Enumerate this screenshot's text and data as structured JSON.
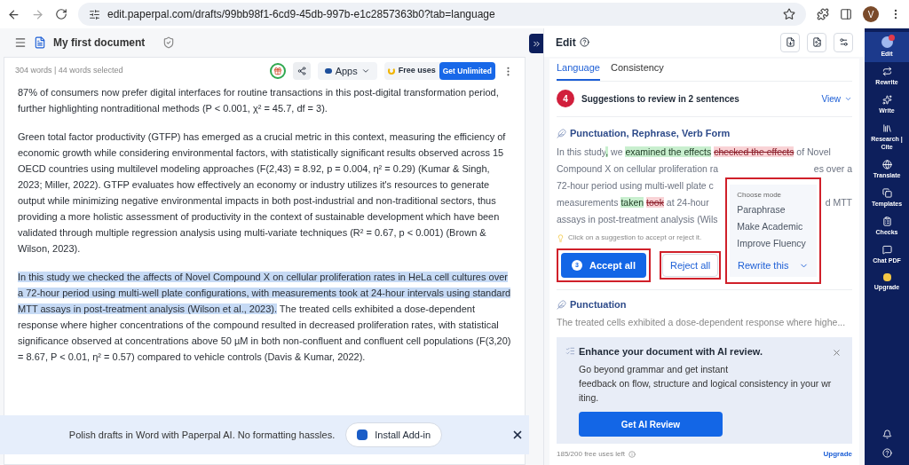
{
  "browser": {
    "url": "edit.paperpal.com/drafts/99bb98f1-6cd9-45db-997b-e1c2857363b0?tab=language",
    "avatar": "V"
  },
  "document": {
    "title": "My first document",
    "word_count": "304 words | 44 words selected",
    "apps": "Apps",
    "free_uses": "Free uses",
    "upgrade_button": "Get Unlimited",
    "paragraphs": [
      [
        {
          "text": "87% of consumers now prefer digital interfaces for routine transactions in this post-digital transformation period, further highlighting nontraditional methods (P < 0.001, χ² = 45.7, df = 3).",
          "selected": false
        }
      ],
      [
        {
          "text": "Green total factor productivity (GTFP) has emerged as a crucial metric in this context, measuring the efficiency of economic growth while considering environmental factors, with statistically significant results observed across 15 OECD countries using multilevel modeling approaches (F(2,43) = 8.92, p = 0.004, η² = 0.29) (Kumar & Singh, 2023; Miller, 2022). GTFP evaluates how effectively an economy or industry utilizes it's resources to generate output while minimizing negative environmental impacts in both post-industrial and non-traditional sectors, thus providing a more holistic assessment of productivity in the context of sustainable development which have been validated through multiple regression analysis using multi-variate techniques (R² = 0.67, p < 0.001) (Brown & Wilson, 2023).",
          "selected": false
        }
      ],
      [
        {
          "text": "In this study we checked the affects of Novel Compound X on cellular proliferation rates in HeLa cell cultures over a 72-hour period using multi-well plate configurations, with measurements took at 24-hour intervals using standard MTT assays in post-treatment analysis (Wilson et al., 2023).",
          "selected": true
        },
        {
          "text": " The treated cells exhibited a dose-dependent response where higher concentrations of the compound resulted in decreased proliferation rates, with statistical significance observed at concentrations above 50 µM in both non-confluent and confluent cell populations (F(3,20) = 8.67, P < 0.01, η² = 0.57) compared to vehicle controls (Davis & Kumar, 2022).",
          "selected": false
        }
      ]
    ]
  },
  "banner": {
    "text": "Polish drafts in Word with Paperpal AI. No formatting hassles.",
    "button": "Install Add-in"
  },
  "panel": {
    "title": "Edit",
    "tabs": [
      {
        "label": "Language",
        "selected": true
      },
      {
        "label": "Consistency",
        "selected": false
      }
    ],
    "summary": {
      "count": "4",
      "text": "Suggestions to review in 2 sentences",
      "view": "View"
    },
    "card": {
      "title": "Punctuation, Rephrase, Verb Form",
      "lines": [
        {
          "left": [
            {
              "text": "In this study",
              "kind": "plain"
            },
            {
              "text": ",",
              "kind": "added"
            },
            {
              "text": " we ",
              "kind": "plain"
            },
            {
              "text": "examined the effects",
              "kind": "added"
            },
            {
              "text": "checked the effects",
              "kind": "removed"
            },
            {
              "text": " of Novel",
              "kind": "plain"
            }
          ]
        },
        {
          "left": [
            {
              "text": "Compound X on cellular proliferation ra",
              "kind": "plain"
            }
          ],
          "right": [
            {
              "text": "es over a",
              "kind": "plain"
            }
          ]
        },
        {
          "left": [
            {
              "text": "72-hour period using multi-well plate c",
              "kind": "plain"
            }
          ]
        },
        {
          "left": [
            {
              "text": "measurements ",
              "kind": "plain"
            },
            {
              "text": "taken",
              "kind": "added"
            },
            {
              "text": "took",
              "kind": "removed"
            },
            {
              "text": " at 24-hour",
              "kind": "plain"
            }
          ],
          "right": [
            {
              "text": "d MTT",
              "kind": "plain"
            }
          ]
        },
        {
          "left": [
            {
              "text": "assays in post-treatment analysis (Wils",
              "kind": "plain"
            }
          ]
        }
      ],
      "hint": "Click on a suggestion to accept or reject it.",
      "accept": "Accept all",
      "accept_count": "3",
      "reject": "Reject all",
      "rewrite": "Rewrite this",
      "menu": {
        "heading": "Choose mode",
        "options": [
          "Paraphrase",
          "Make Academic",
          "Improve Fluency"
        ]
      }
    },
    "card2": {
      "title": "Punctuation",
      "preview": "The treated cells exhibited a dose-dependent response where highe..."
    },
    "promo": {
      "title": "Enhance your document with AI review.",
      "lines": [
        "Go beyond grammar and get instant",
        "feedback on flow, structure and logical consistency in your wr",
        "iting."
      ],
      "button": "Get AI Review"
    },
    "footer": {
      "uses": "185/200 free uses left",
      "upgrade": "Upgrade"
    }
  },
  "rail": [
    {
      "label": "Edit",
      "selected": true
    },
    {
      "label": "Rewrite",
      "selected": false
    },
    {
      "label": "Write",
      "selected": false
    },
    {
      "label": "Research | Cite",
      "selected": false
    },
    {
      "label": "Translate",
      "selected": false
    },
    {
      "label": "Templates",
      "selected": false
    },
    {
      "label": "Checks",
      "selected": false
    },
    {
      "label": "Chat PDF",
      "selected": false
    },
    {
      "label": "Upgrade",
      "selected": false
    }
  ]
}
